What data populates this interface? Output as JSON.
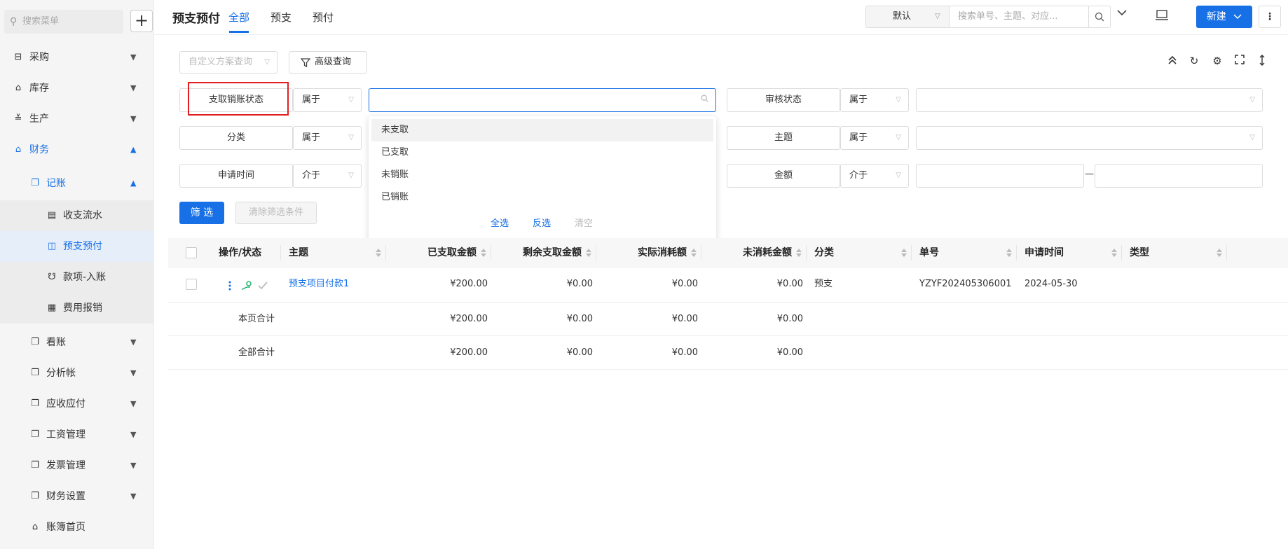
{
  "sidebar": {
    "search_placeholder": "搜索菜单",
    "add_label": "+",
    "items": [
      {
        "label": "采购"
      },
      {
        "label": "库存"
      },
      {
        "label": "生产"
      },
      {
        "label": "财务"
      },
      {
        "label": "记账"
      },
      {
        "label": "收支流水"
      },
      {
        "label": "预支预付"
      },
      {
        "label": "款项-入账"
      },
      {
        "label": "费用报销"
      },
      {
        "label": "看账"
      },
      {
        "label": "分析帐"
      },
      {
        "label": "应收应付"
      },
      {
        "label": "工资管理"
      },
      {
        "label": "发票管理"
      },
      {
        "label": "财务设置"
      },
      {
        "label": "账簿首页"
      }
    ]
  },
  "header": {
    "title": "预支预付",
    "tabs": [
      {
        "label": "全部"
      },
      {
        "label": "预支"
      },
      {
        "label": "预付"
      }
    ],
    "view_select": "默认",
    "search_placeholder": "搜索单号、主题、对应...",
    "new_label": "新建",
    "more_label": "⋮"
  },
  "filter": {
    "scheme_placeholder": "自定义方案查询",
    "advanced_label": "高级查询",
    "rows": [
      {
        "field": "支取销账状态",
        "op": "属于"
      },
      {
        "field": "分类",
        "op": "属于"
      },
      {
        "field": "申请时间",
        "op": "介于"
      }
    ],
    "right_rows": [
      {
        "field": "审核状态",
        "op": "属于"
      },
      {
        "field": "主题",
        "op": "属于"
      },
      {
        "field": "金额",
        "op": "介于",
        "dash": "—"
      }
    ],
    "dropdown_options": [
      "未支取",
      "已支取",
      "未销账",
      "已销账"
    ],
    "dropdown_actions": {
      "select_all": "全选",
      "invert": "反选",
      "clear": "清空"
    },
    "filter_button": "筛 选",
    "clear_button": "清除筛选条件"
  },
  "table": {
    "columns": [
      "操作/状态",
      "主题",
      "已支取金额",
      "剩余支取金额",
      "实际消耗额",
      "未消耗金额",
      "分类",
      "单号",
      "申请时间",
      "类型"
    ],
    "rows": [
      {
        "subject": "预支项目付款1",
        "paid": "¥200.00",
        "remaining": "¥0.00",
        "consumed": "¥0.00",
        "unconsumed": "¥0.00",
        "category": "预支",
        "number": "YZYF202405306001",
        "date": "2024-05-30",
        "type": ""
      }
    ],
    "summaries": [
      {
        "label": "本页合计",
        "paid": "¥200.00",
        "remaining": "¥0.00",
        "consumed": "¥0.00",
        "unconsumed": "¥0.00"
      },
      {
        "label": "全部合计",
        "paid": "¥200.00",
        "remaining": "¥0.00",
        "consumed": "¥0.00",
        "unconsumed": "¥0.00"
      }
    ]
  },
  "colors": {
    "accent": "#1770e6",
    "highlight": "#e02020",
    "green": "#2bb673"
  }
}
